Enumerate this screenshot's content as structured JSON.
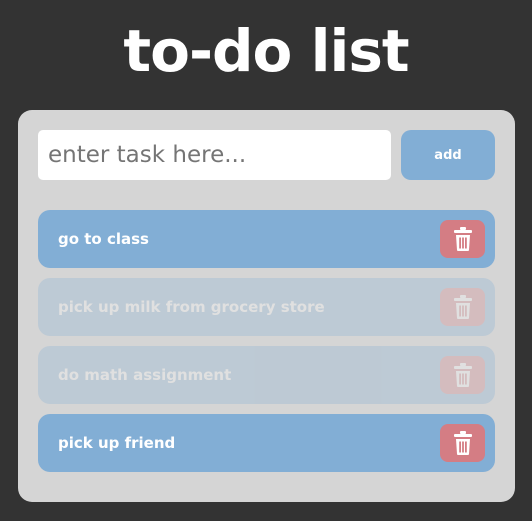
{
  "header": {
    "title": "to-do list"
  },
  "form": {
    "placeholder": "enter task here...",
    "value": "",
    "add_label": "add"
  },
  "tasks": [
    {
      "text": "go to class",
      "completed": false
    },
    {
      "text": "pick up milk from grocery store",
      "completed": true
    },
    {
      "text": "do math assignment",
      "completed": true
    },
    {
      "text": "pick up friend",
      "completed": false
    }
  ],
  "colors": {
    "background": "#333333",
    "card": "#d5d5d5",
    "accent": "#82aed5",
    "delete": "#d47d84"
  },
  "icons": {
    "delete": "trash-icon"
  }
}
